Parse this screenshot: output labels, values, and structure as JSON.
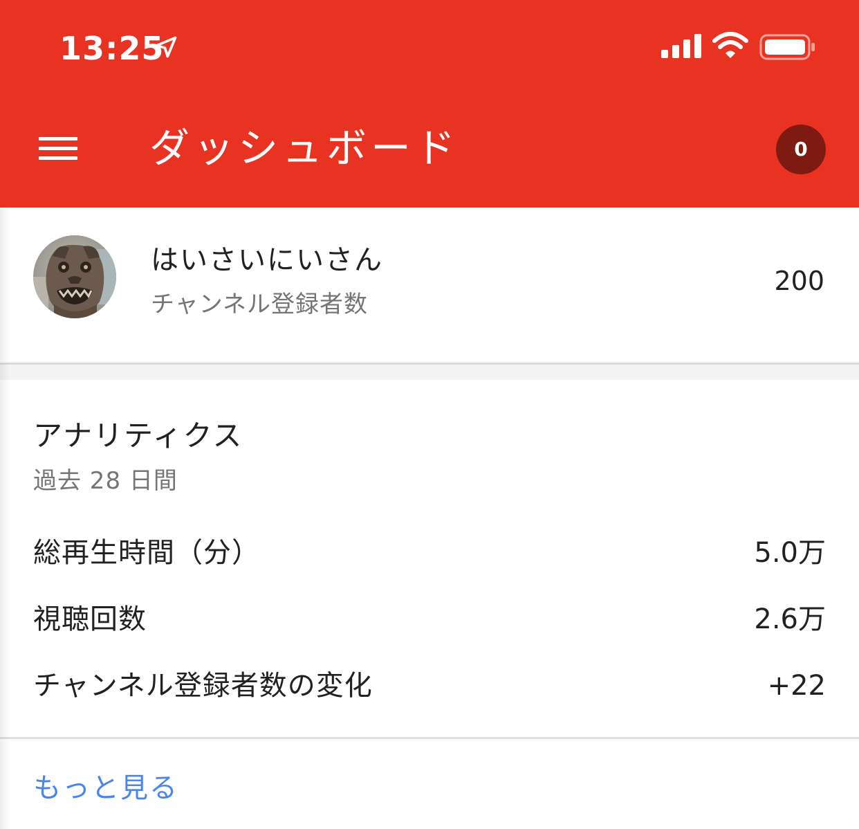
{
  "status_bar": {
    "time": "13:25",
    "location_icon": "location-arrow-icon",
    "signal_icon": "cellular-signal-icon",
    "wifi_icon": "wifi-icon",
    "battery_icon": "battery-icon"
  },
  "app_bar": {
    "menu_icon": "hamburger-menu-icon",
    "title": "ダッシュボード",
    "notification_count": "0",
    "background_color": "#e83323",
    "badge_color": "#7d1a11"
  },
  "channel": {
    "name": "はいさいにいさん",
    "subscriber_label": "チャンネル登録者数",
    "subscriber_count": "200",
    "avatar_icon": "shisa-avatar-icon"
  },
  "analytics": {
    "title": "アナリティクス",
    "period": "過去 28 日間",
    "metrics": [
      {
        "label": "総再生時間（分）",
        "value": "5.0万"
      },
      {
        "label": "視聴回数",
        "value": "2.6万"
      },
      {
        "label": "チャンネル登録者数の変化",
        "value": "+22"
      }
    ],
    "more_link": "もっと見る",
    "link_color": "#4a86e8"
  }
}
